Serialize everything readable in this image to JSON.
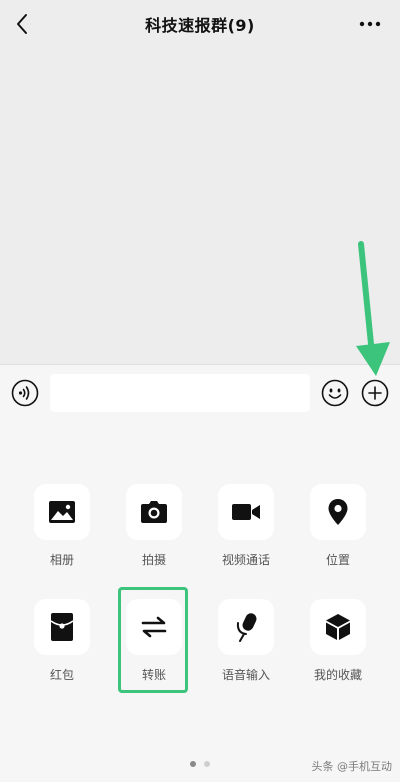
{
  "header": {
    "title": "科技速报群(9)",
    "back_icon": "chevron-left-icon",
    "more_icon": "more-dots-icon"
  },
  "input_bar": {
    "voice_icon": "voice-icon",
    "text_value": "",
    "emoji_icon": "emoji-icon",
    "plus_icon": "plus-circle-icon"
  },
  "panel": {
    "items": [
      {
        "label": "相册",
        "icon": "image-icon"
      },
      {
        "label": "拍摄",
        "icon": "camera-icon"
      },
      {
        "label": "视频通话",
        "icon": "video-icon"
      },
      {
        "label": "位置",
        "icon": "location-icon"
      },
      {
        "label": "红包",
        "icon": "red-packet-icon"
      },
      {
        "label": "转账",
        "icon": "transfer-icon"
      },
      {
        "label": "语音输入",
        "icon": "microphone-icon"
      },
      {
        "label": "我的收藏",
        "icon": "favorites-cube-icon"
      }
    ],
    "page_count": 2,
    "current_page": 1
  },
  "annotations": {
    "highlight_color": "#3cc47c",
    "highlighted_item": "转账",
    "arrow_target": "plus-button"
  },
  "watermark": {
    "text": "头条 @手机互动"
  }
}
